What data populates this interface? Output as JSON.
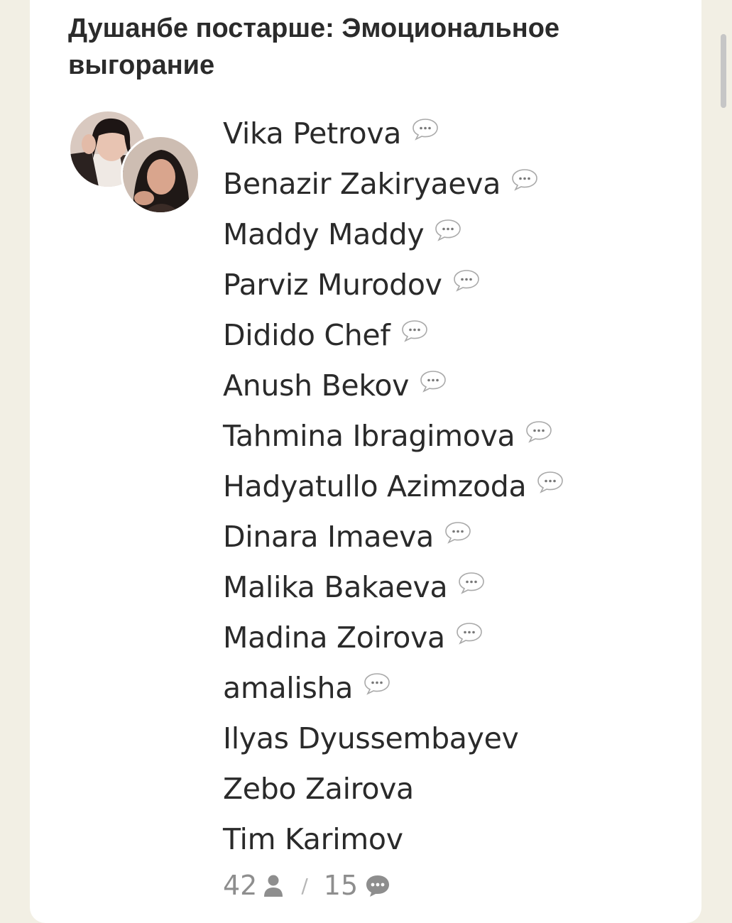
{
  "room": {
    "title": "Душанбе постарше: Эмоциональное выгорание",
    "speakers": [
      {
        "name": "Vika Petrova",
        "speaking_icon": "speech-bubble-icon"
      },
      {
        "name": "Benazir Zakiryaeva",
        "speaking_icon": "speech-bubble-icon"
      },
      {
        "name": "Maddy Maddy",
        "speaking_icon": "speech-bubble-icon"
      },
      {
        "name": "Parviz Murodov",
        "speaking_icon": "speech-bubble-icon"
      },
      {
        "name": "Didido Chef",
        "speaking_icon": "speech-bubble-icon"
      },
      {
        "name": "Anush Bekov",
        "speaking_icon": "speech-bubble-icon"
      },
      {
        "name": "Tahmina Ibragimova",
        "speaking_icon": "speech-bubble-icon"
      },
      {
        "name": "Hadyatullo Azimzoda",
        "speaking_icon": "speech-bubble-icon"
      },
      {
        "name": "Dinara Imaeva",
        "speaking_icon": "speech-bubble-icon"
      },
      {
        "name": "Malika Bakaeva",
        "speaking_icon": "speech-bubble-icon"
      },
      {
        "name": "Madina Zoirova",
        "speaking_icon": "speech-bubble-icon"
      },
      {
        "name": "amalisha",
        "speaking_icon": "speech-bubble-icon"
      },
      {
        "name": "Ilyas Dyussembayev",
        "speaking_icon": null
      },
      {
        "name": "Zebo Zairova",
        "speaking_icon": null
      },
      {
        "name": "Tim Karimov",
        "speaking_icon": null
      }
    ],
    "stats": {
      "listeners": "42",
      "listeners_icon": "person-icon",
      "separator": "/",
      "speakers": "15",
      "speakers_icon": "chat-bubble-icon"
    }
  },
  "colors": {
    "page_background": "#f2efe4",
    "card_background": "#ffffff",
    "text": "#2a2a2a",
    "muted": "#8e8e8e"
  }
}
